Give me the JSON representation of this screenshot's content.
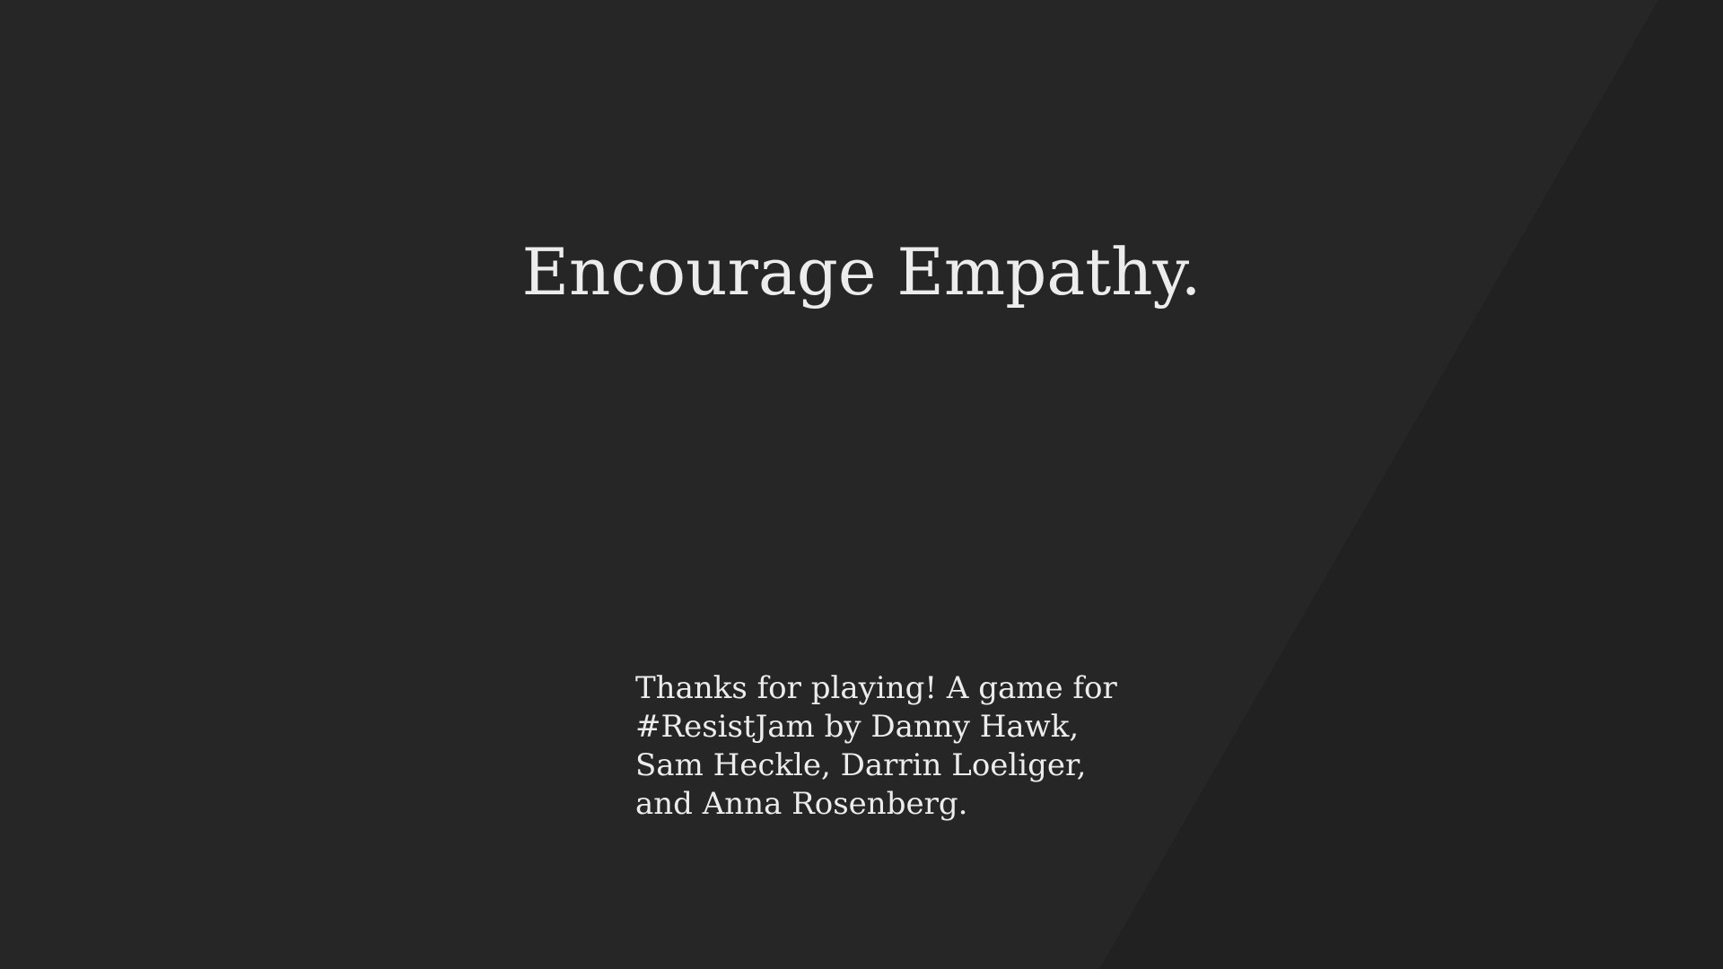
{
  "screen": {
    "title": "Encourage Empathy.",
    "credits_lines": [
      "Thanks for playing! A game for",
      "#ResistJam by Danny Hawk,",
      "Sam Heckle, Darrin Loeliger,",
      "and Anna Rosenberg."
    ]
  },
  "colors": {
    "background": "#262626",
    "shade": "#202020",
    "text": "#ececec"
  }
}
